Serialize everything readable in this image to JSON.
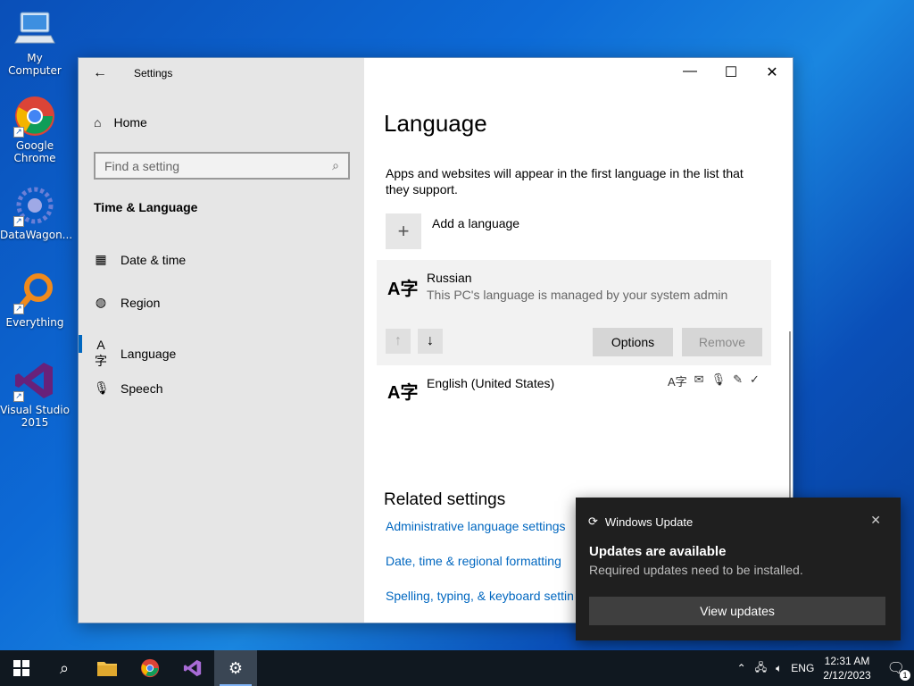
{
  "desktop": {
    "icons": [
      {
        "label": "My Computer",
        "icon": "computer-icon"
      },
      {
        "label": "Google Chrome",
        "icon": "chrome-icon"
      },
      {
        "label": "DataWagon...",
        "icon": "datawagon-icon"
      },
      {
        "label": "Everything",
        "icon": "search-magnifier-icon"
      },
      {
        "label": "Visual Studio 2015",
        "icon": "visual-studio-icon"
      }
    ]
  },
  "window": {
    "app_title": "Settings",
    "sidebar": {
      "home": "Home",
      "search_placeholder": "Find a setting",
      "section": "Time & Language",
      "items": [
        {
          "label": "Date & time",
          "icon": "calendar-clock-icon"
        },
        {
          "label": "Region",
          "icon": "globe-icon"
        },
        {
          "label": "Language",
          "icon": "language-icon",
          "selected": true
        },
        {
          "label": "Speech",
          "icon": "microphone-icon"
        }
      ]
    },
    "content": {
      "title": "Language",
      "description": "Apps and websites will appear in the first language in the list that they support.",
      "add_language": "Add a language",
      "languages": [
        {
          "name": "Russian",
          "subtitle": "This PC's language is managed by your system admin",
          "options_label": "Options",
          "remove_label": "Remove"
        },
        {
          "name": "English (United States)"
        }
      ],
      "related_heading": "Related settings",
      "related_links": [
        "Administrative language settings",
        "Date, time & regional formatting",
        "Spelling, typing, & keyboard settin"
      ]
    }
  },
  "toast": {
    "app": "Windows Update",
    "title": "Updates are available",
    "body": "Required updates need to be installed.",
    "action": "View updates"
  },
  "taskbar": {
    "input_lang": "ENG",
    "time": "12:31 AM",
    "date": "2/12/2023",
    "notification_count": "1"
  },
  "colors": {
    "accent": "#0067c0",
    "toast_bg": "#1f1f1f",
    "taskbar_bg": "#101820"
  }
}
